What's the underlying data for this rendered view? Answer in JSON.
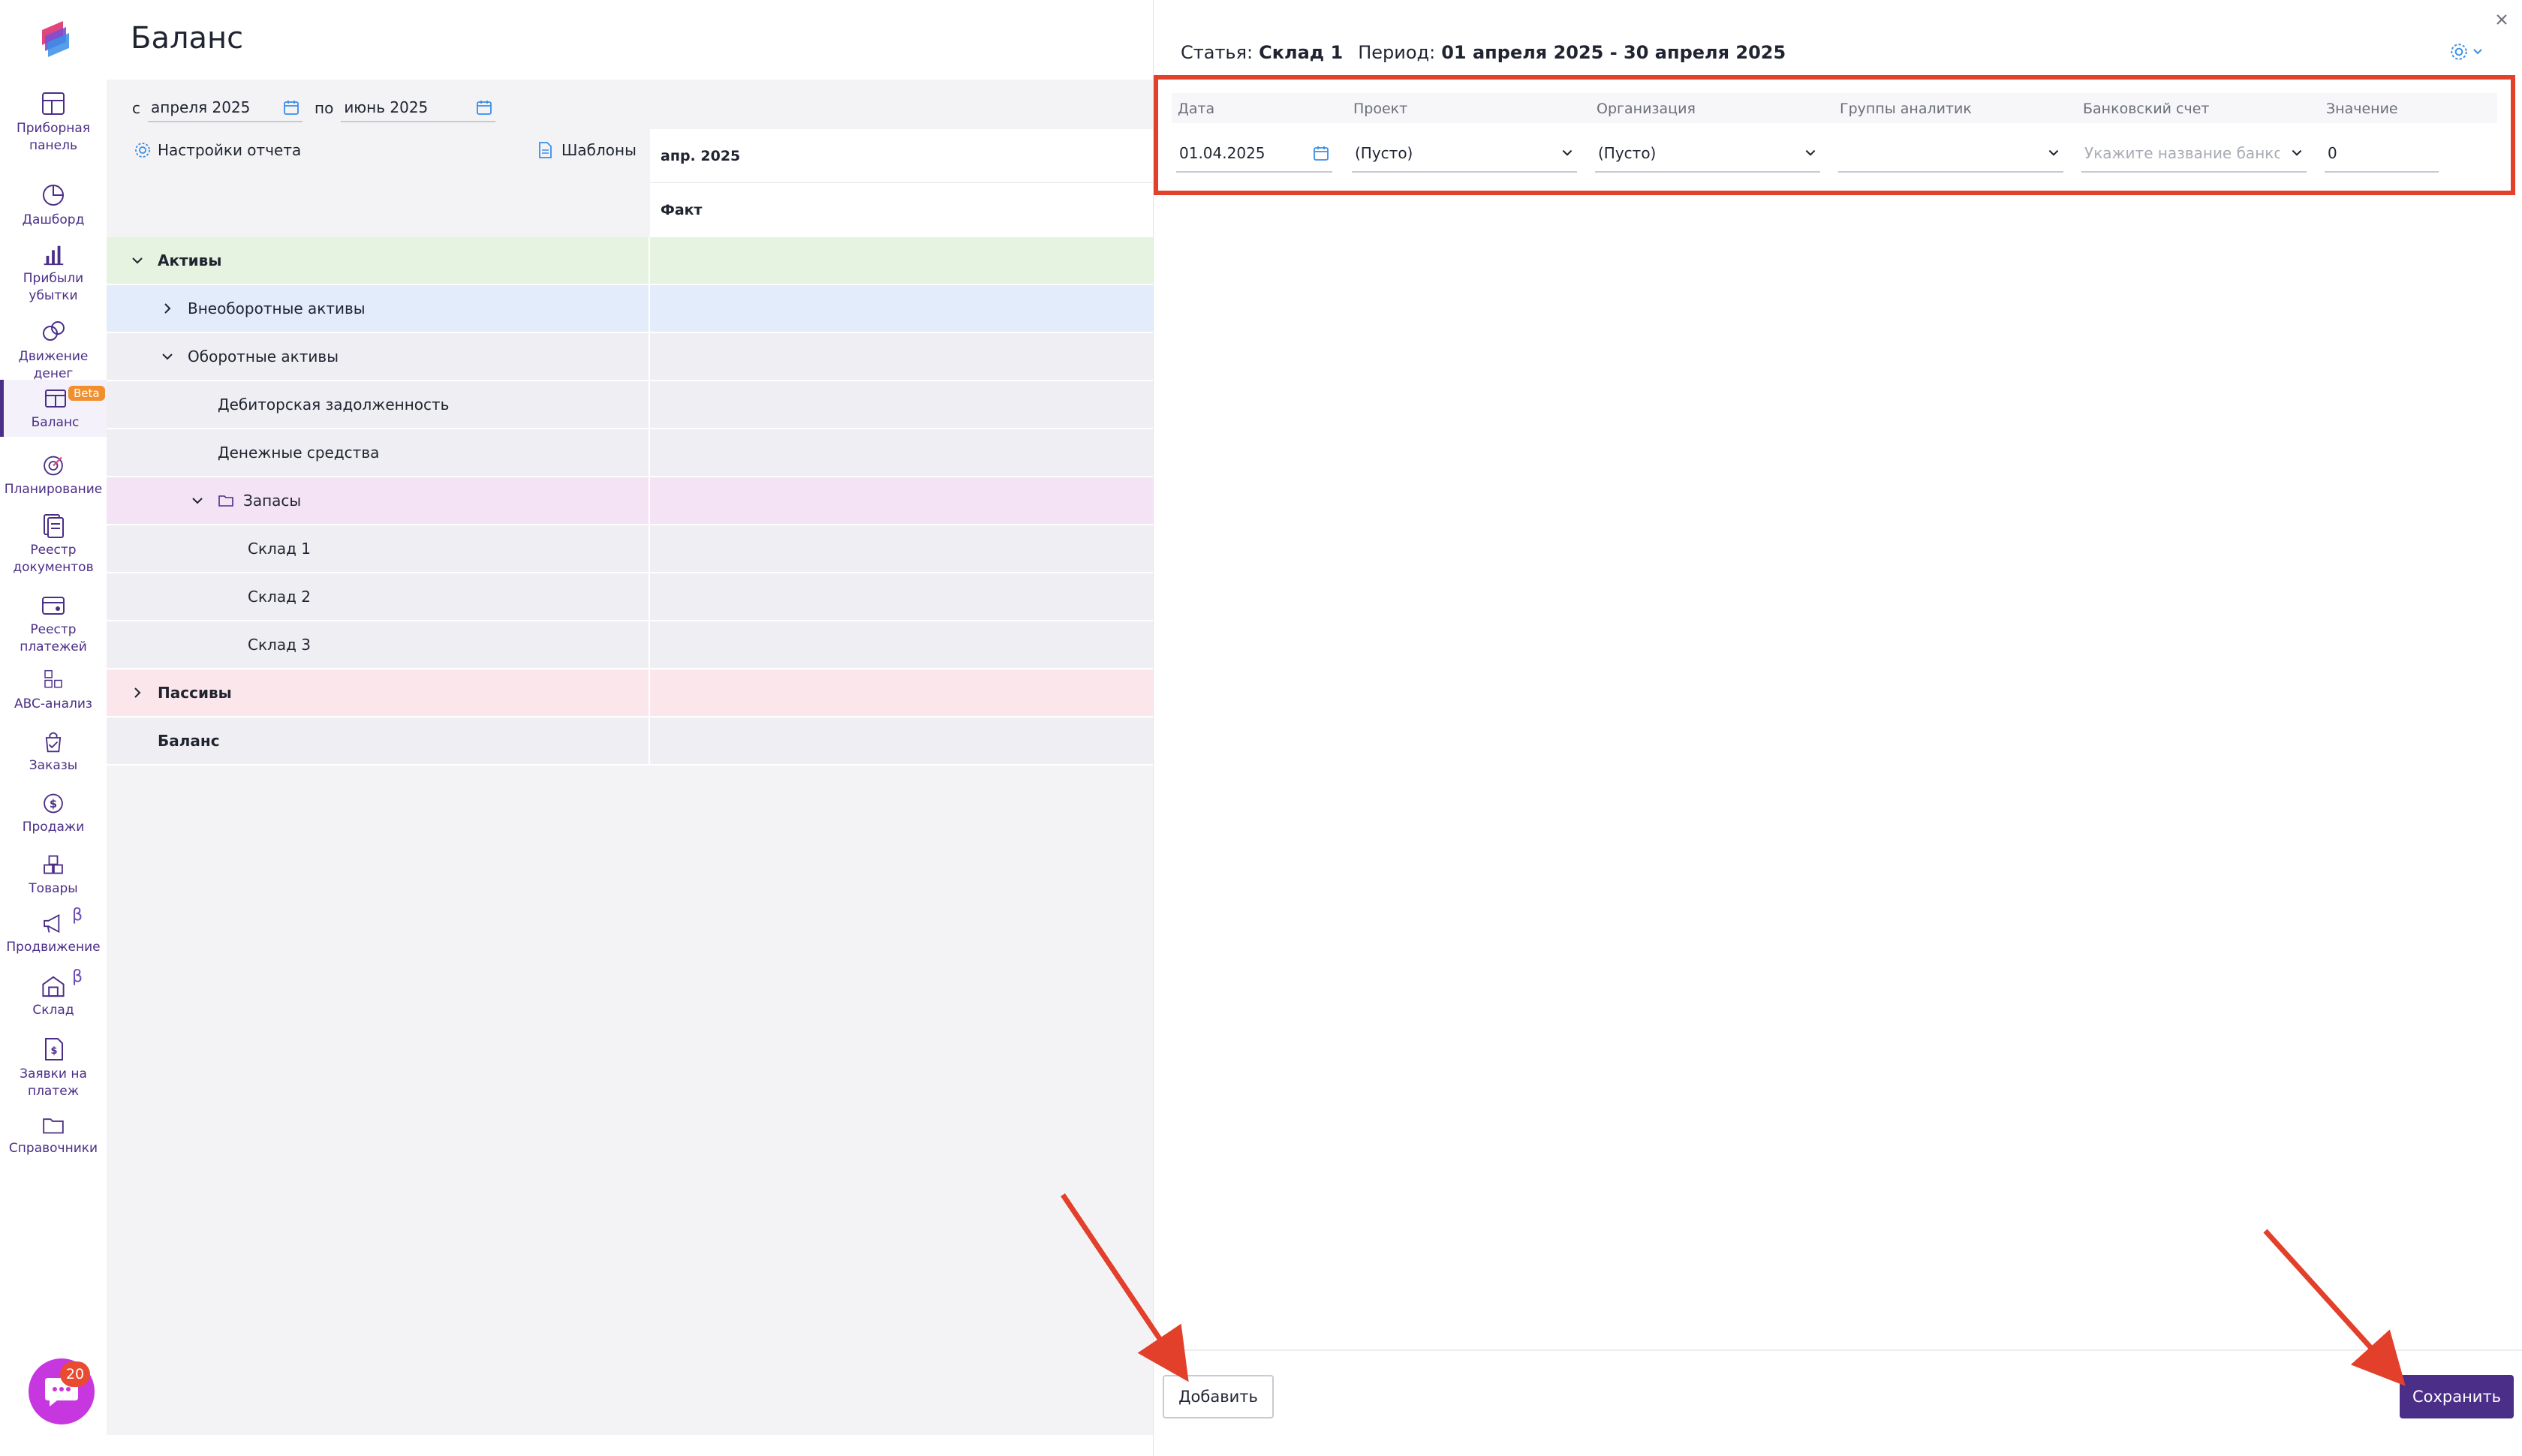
{
  "page": {
    "title": "Баланс"
  },
  "sidebar": {
    "items": [
      {
        "label": "Приборная\nпанель",
        "icon": "dashboard-panel-icon"
      },
      {
        "label": "Дашборд",
        "icon": "pie-chart-icon"
      },
      {
        "label": "Прибыли\nубытки",
        "icon": "bar-chart-icon"
      },
      {
        "label": "Движение\nденег",
        "icon": "money-flow-icon"
      },
      {
        "label": "Баланс",
        "icon": "balance-icon",
        "badge": "Beta",
        "active": true
      },
      {
        "label": "Планирование",
        "icon": "target-icon"
      },
      {
        "label": "Реестр\nдокументов",
        "icon": "documents-registry-icon"
      },
      {
        "label": "Реестр\nплатежей",
        "icon": "payments-registry-icon"
      },
      {
        "label": "ABC-анализ",
        "icon": "abc-icon"
      },
      {
        "label": "Заказы",
        "icon": "orders-bag-icon"
      },
      {
        "label": "Продажи",
        "icon": "dollar-icon"
      },
      {
        "label": "Товары",
        "icon": "boxes-icon"
      },
      {
        "label": "Продвижение",
        "icon": "megaphone-icon",
        "beta_sign": "β"
      },
      {
        "label": "Склад",
        "icon": "warehouse-icon",
        "beta_sign": "β"
      },
      {
        "label": "Заявки на\nплатеж",
        "icon": "payment-request-icon"
      },
      {
        "label": "Справочники",
        "icon": "folder-icon"
      }
    ],
    "chat_badge": "20"
  },
  "filters": {
    "from_label": "с",
    "from_value": "апреля 2025",
    "to_label": "по",
    "to_value": "июнь 2025"
  },
  "toolbar": {
    "report_settings": "Настройки отчета",
    "templates": "Шаблоны"
  },
  "columns": {
    "month": "апр. 2025",
    "kind": "Факт"
  },
  "rows": [
    {
      "name": "Активы",
      "indent": 0,
      "chevron": "down",
      "bold": true,
      "bg": "#e6f3e1"
    },
    {
      "name": "Внеоборотные активы",
      "indent": 1,
      "chevron": "right",
      "bold": false,
      "bg": "#e3ecfa"
    },
    {
      "name": "Оборотные активы",
      "indent": 1,
      "chevron": "down",
      "bold": false,
      "bg": "#efeff3"
    },
    {
      "name": "Дебиторская задолженность",
      "indent": 2,
      "chevron": "",
      "bold": false,
      "bg": "#efeff3"
    },
    {
      "name": "Денежные средства",
      "indent": 2,
      "chevron": "",
      "bold": false,
      "bg": "#efeff3"
    },
    {
      "name": "Запасы",
      "indent": 2,
      "chevron": "down",
      "folder": true,
      "bold": false,
      "bg": "#f4e3f5"
    },
    {
      "name": "Склад 1",
      "indent": 3,
      "chevron": "",
      "bold": false,
      "bg": "#efeff3"
    },
    {
      "name": "Склад 2",
      "indent": 3,
      "chevron": "",
      "bold": false,
      "bg": "#efeff3"
    },
    {
      "name": "Склад 3",
      "indent": 3,
      "chevron": "",
      "bold": false,
      "bg": "#efeff3"
    },
    {
      "name": "Пассивы",
      "indent": 0,
      "chevron": "right",
      "bold": true,
      "bg": "#fbe6ec"
    },
    {
      "name": "Баланс",
      "indent": 0,
      "chevron": "",
      "bold": true,
      "bg": "#efeff3"
    }
  ],
  "panel": {
    "article_label": "Статья:",
    "article_value": "Склад 1",
    "period_label": "Период:",
    "period_value": "01 апреля 2025 - 30 апреля 2025",
    "headers": {
      "date": "Дата",
      "project": "Проект",
      "organization": "Организация",
      "analytics_groups": "Группы аналитик",
      "bank_account": "Банковский счет",
      "value": "Значение"
    },
    "fields": {
      "date": "01.04.2025",
      "project": "(Пусто)",
      "organization": "(Пусто)",
      "analytics_groups": "",
      "bank_account_placeholder": "Укажите название банковс",
      "value": "0"
    },
    "add_label": "Добавить",
    "save_label": "Сохранить"
  },
  "colors": {
    "brand": "#4b2e87",
    "highlight": "#e3402b",
    "chat": "#c737e0"
  }
}
